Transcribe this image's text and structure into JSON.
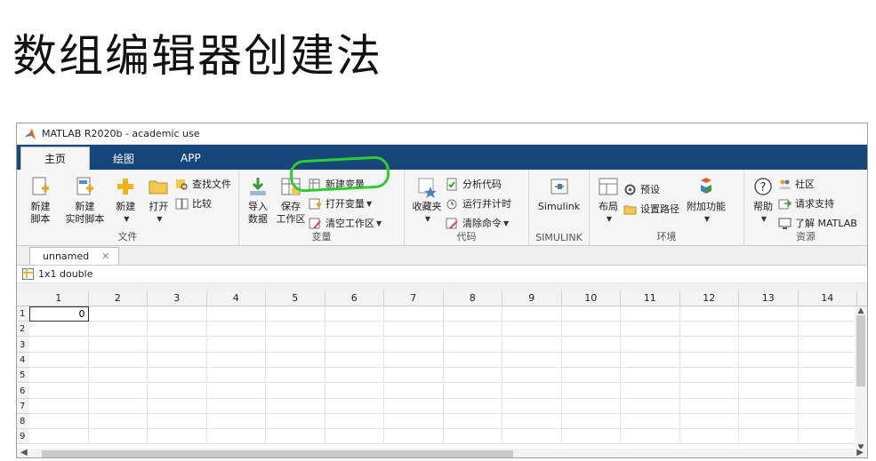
{
  "slide": {
    "title": "数组编辑器创建法"
  },
  "window": {
    "title": "MATLAB R2020b - academic use"
  },
  "tabs": [
    {
      "label": "主页"
    },
    {
      "label": "绘图"
    },
    {
      "label": "APP"
    }
  ],
  "ribbon": {
    "file": {
      "label": "文件",
      "new_script": "新建\n脚本",
      "new_live_script": "新建\n实时脚本",
      "new": "新建",
      "open": "打开",
      "find_files": "查找文件",
      "compare": "比较"
    },
    "variable": {
      "label": "变量",
      "import": "导入\n数据",
      "save_ws": "保存\n工作区",
      "new_var": "新建变量",
      "open_var": "打开变量",
      "clear_ws": "清空工作区"
    },
    "code": {
      "label": "代码",
      "favorites": "收藏夹",
      "analyze": "分析代码",
      "run_time": "运行并计时",
      "clear_cmd": "清除命令"
    },
    "simulink": {
      "label": "SIMULINK",
      "btn": "Simulink"
    },
    "env": {
      "label": "环境",
      "layout": "布局",
      "prefs": "预设",
      "set_path": "设置路径",
      "addons": "附加功能"
    },
    "resources": {
      "label": "资源",
      "help": "帮助",
      "community": "社区",
      "support": "请求支持",
      "learn": "了解 MATLAB"
    }
  },
  "editor": {
    "doc_tab": "unnamed",
    "var_info": "1x1 double",
    "columns": [
      "1",
      "2",
      "3",
      "4",
      "5",
      "6",
      "7",
      "8",
      "9",
      "10",
      "11",
      "12",
      "13",
      "14"
    ],
    "rows": [
      "1",
      "2",
      "3",
      "4",
      "5",
      "6",
      "7",
      "8",
      "9"
    ],
    "cell_value": "0"
  }
}
